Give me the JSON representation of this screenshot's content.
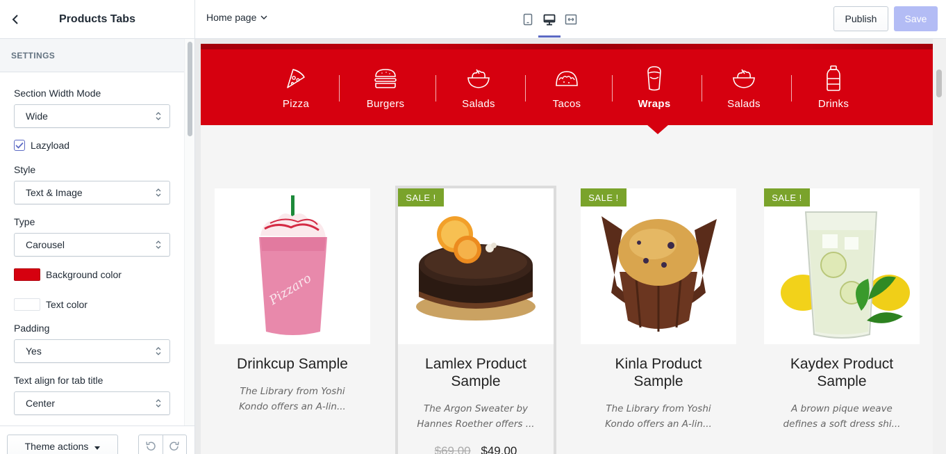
{
  "sidebar": {
    "title": "Products Tabs",
    "section_heading": "SETTINGS",
    "fields": {
      "width_mode_label": "Section Width Mode",
      "width_mode_value": "Wide",
      "lazyload_label": "Lazyload",
      "lazyload_checked": true,
      "style_label": "Style",
      "style_value": "Text & Image",
      "type_label": "Type",
      "type_value": "Carousel",
      "bg_color_label": "Background color",
      "bg_color": "#d6000f",
      "text_color_label": "Text color",
      "text_color": "#ffffff",
      "padding_label": "Padding",
      "padding_value": "Yes",
      "align_label": "Text align for tab title",
      "align_value": "Center"
    },
    "footer": {
      "theme_actions": "Theme actions"
    }
  },
  "topbar": {
    "page": "Home page",
    "devices": [
      "mobile-icon",
      "desktop-icon",
      "fullscreen-icon"
    ],
    "active_device": "desktop",
    "publish": "Publish",
    "save": "Save"
  },
  "tabs": [
    {
      "label": "Pizza",
      "icon": "pizza-icon"
    },
    {
      "label": "Burgers",
      "icon": "burger-icon"
    },
    {
      "label": "Salads",
      "icon": "salad-icon"
    },
    {
      "label": "Tacos",
      "icon": "taco-icon"
    },
    {
      "label": "Wraps",
      "icon": "wrap-icon",
      "active": true
    },
    {
      "label": "Salads",
      "icon": "salad-icon"
    },
    {
      "label": "Drinks",
      "icon": "drink-icon"
    }
  ],
  "products": [
    {
      "title": "Drinkcup Sample",
      "desc": "The Library from Yoshi Kondo offers an A-lin...",
      "sale": null,
      "image": "milkshake"
    },
    {
      "title": "Lamlex Product Sample",
      "desc": "The Argon Sweater by Hannes Roether offers ...",
      "sale": "SALE !",
      "old_price": "$69.00",
      "price": "$49.00",
      "image": "cake"
    },
    {
      "title": "Kinla Product Sample",
      "desc": "The Library from Yoshi Kondo offers an A-lin...",
      "sale": "SALE !",
      "image": "muffin"
    },
    {
      "title": "Kaydex Product Sample",
      "desc": "A brown pique weave defines a soft dress shi...",
      "sale": "SALE !",
      "image": "lemonade"
    }
  ],
  "colors": {
    "accent": "#5c6ac4",
    "tab_bg": "#d6000f",
    "sale_badge": "#7aa32b",
    "save_disabled": "#b3bcf5"
  }
}
